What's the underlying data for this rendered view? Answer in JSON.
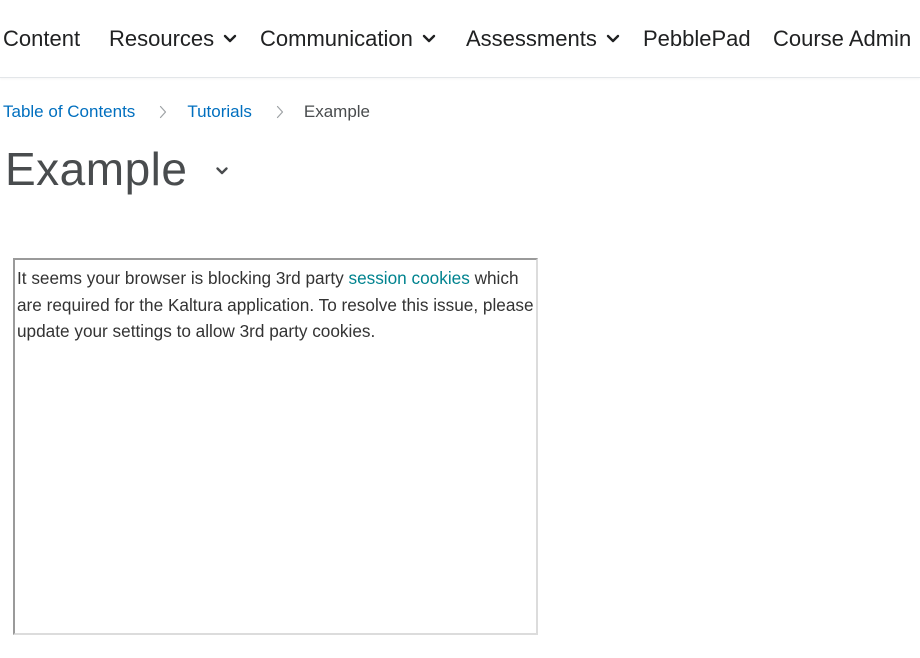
{
  "nav": {
    "items": [
      {
        "label": "Content",
        "dropdown": false
      },
      {
        "label": "Resources",
        "dropdown": true
      },
      {
        "label": "Communication",
        "dropdown": true
      },
      {
        "label": "Assessments",
        "dropdown": true
      },
      {
        "label": "PebblePad",
        "dropdown": false
      },
      {
        "label": "Course Admin",
        "dropdown": false
      }
    ]
  },
  "breadcrumb": {
    "items": [
      "Table of Contents",
      "Tutorials"
    ],
    "current": "Example"
  },
  "page": {
    "title": "Example"
  },
  "embed": {
    "message_before": "It seems your browser is blocking 3rd party ",
    "link_text": "session cookies",
    "message_after": " which are required for the Kaltura application. To resolve this issue, please update your settings to allow 3rd party cookies."
  },
  "colors": {
    "link": "#006fbf",
    "embed_link": "#00838f",
    "title": "#494c4e"
  },
  "icons": {
    "nav_dropdown": "chevron-down-icon",
    "breadcrumb_separator": "chevron-right-icon",
    "title_menu": "chevron-down-icon"
  }
}
